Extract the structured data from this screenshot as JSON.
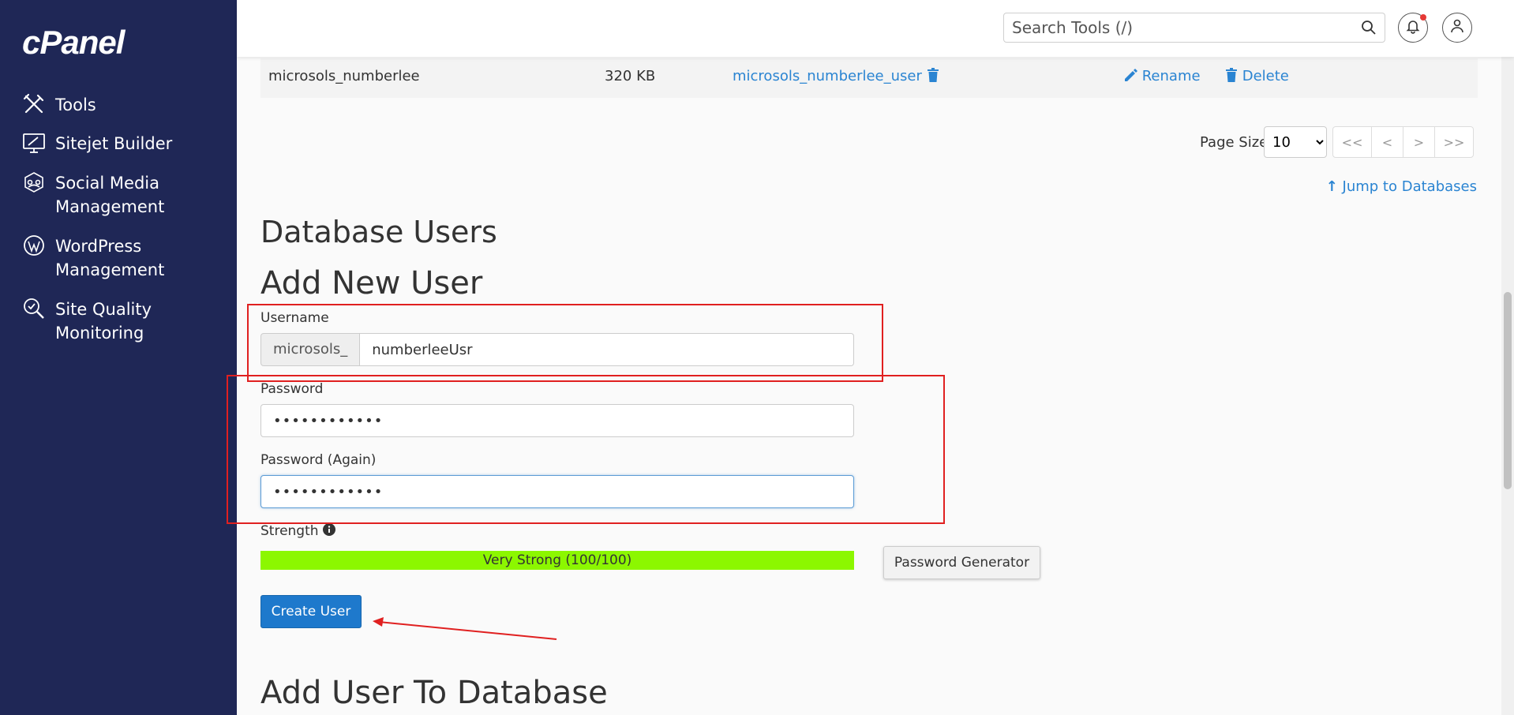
{
  "brand": {
    "logo": "cPanel"
  },
  "sidebar": {
    "items": [
      {
        "label": "Tools",
        "icon": "tools-icon"
      },
      {
        "label": "Sitejet Builder",
        "icon": "sitejet-icon"
      },
      {
        "label": "Social Media\nManagement",
        "icon": "social-media-icon"
      },
      {
        "label": "WordPress\nManagement",
        "icon": "wordpress-icon"
      },
      {
        "label": "Site Quality\nMonitoring",
        "icon": "site-quality-icon"
      }
    ]
  },
  "header": {
    "search_placeholder": "Search Tools (/)"
  },
  "db_row": {
    "name": "microsols_numberlee",
    "size": "320 KB",
    "user": "microsols_numberlee_user",
    "rename": "Rename",
    "delete": "Delete"
  },
  "pager": {
    "page_size_label": "Page Size",
    "page_size": "10",
    "buttons": [
      "<<",
      "<",
      ">",
      ">>"
    ]
  },
  "jump_link": "Jump to Databases",
  "section_title": "Database Users",
  "form": {
    "title": "Add New User",
    "username_label": "Username",
    "username_prefix": "microsols_",
    "username_value": "numberleeUsr",
    "password_label": "Password",
    "password_value": "••••••••••••",
    "password_again_label": "Password (Again)",
    "password_again_value": "••••••••••••",
    "strength_label": "Strength",
    "strength_text": "Very Strong (100/100)",
    "strength_score": 100,
    "password_generator": "Password Generator",
    "create_button": "Create User"
  },
  "next_section_title": "Add User To Database",
  "colors": {
    "sidebar_bg": "#1f2756",
    "strength_bar": "#8cf700",
    "primary_button": "#1e79cc",
    "link": "#2a84d2",
    "annotation": "#e02020"
  }
}
